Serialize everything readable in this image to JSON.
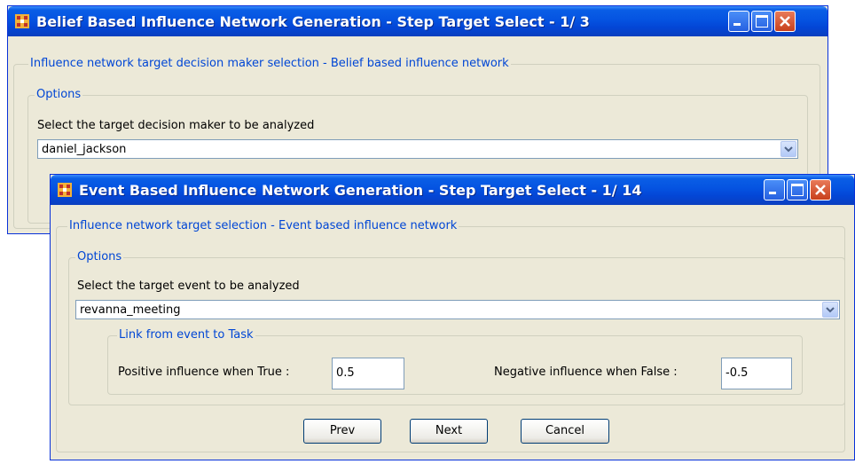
{
  "window_back": {
    "title": "Belief Based Influence Network Generation - Step Target Select - 1/ 3",
    "outer_group_label": "Influence network target decision maker selection - Belief based influence network",
    "options_label": "Options",
    "prompt": "Select the target decision maker to be analyzed",
    "selected_value": "daniel_jackson"
  },
  "window_front": {
    "title": "Event Based Influence Network Generation - Step Target Select - 1/ 14",
    "outer_group_label": "Influence network target selection - Event based influence network",
    "options_label": "Options",
    "prompt": "Select the target event to be analyzed",
    "selected_value": "revanna_meeting",
    "link_group_label": "Link from event to Task",
    "positive_label": "Positive influence when True :",
    "positive_value": "0.5",
    "negative_label": "Negative influence when False :",
    "negative_value": "-0.5",
    "buttons": {
      "prev": "Prev",
      "next": "Next",
      "cancel": "Cancel"
    }
  },
  "icons": [
    "app-icon",
    "minimize-icon",
    "maximize-icon",
    "close-icon",
    "dropdown-arrow-icon"
  ],
  "colors": {
    "title_bar": "#0553e1",
    "group_label": "#0046d5",
    "dialog_bg": "#ece9d8",
    "close_button": "#d8552c"
  }
}
